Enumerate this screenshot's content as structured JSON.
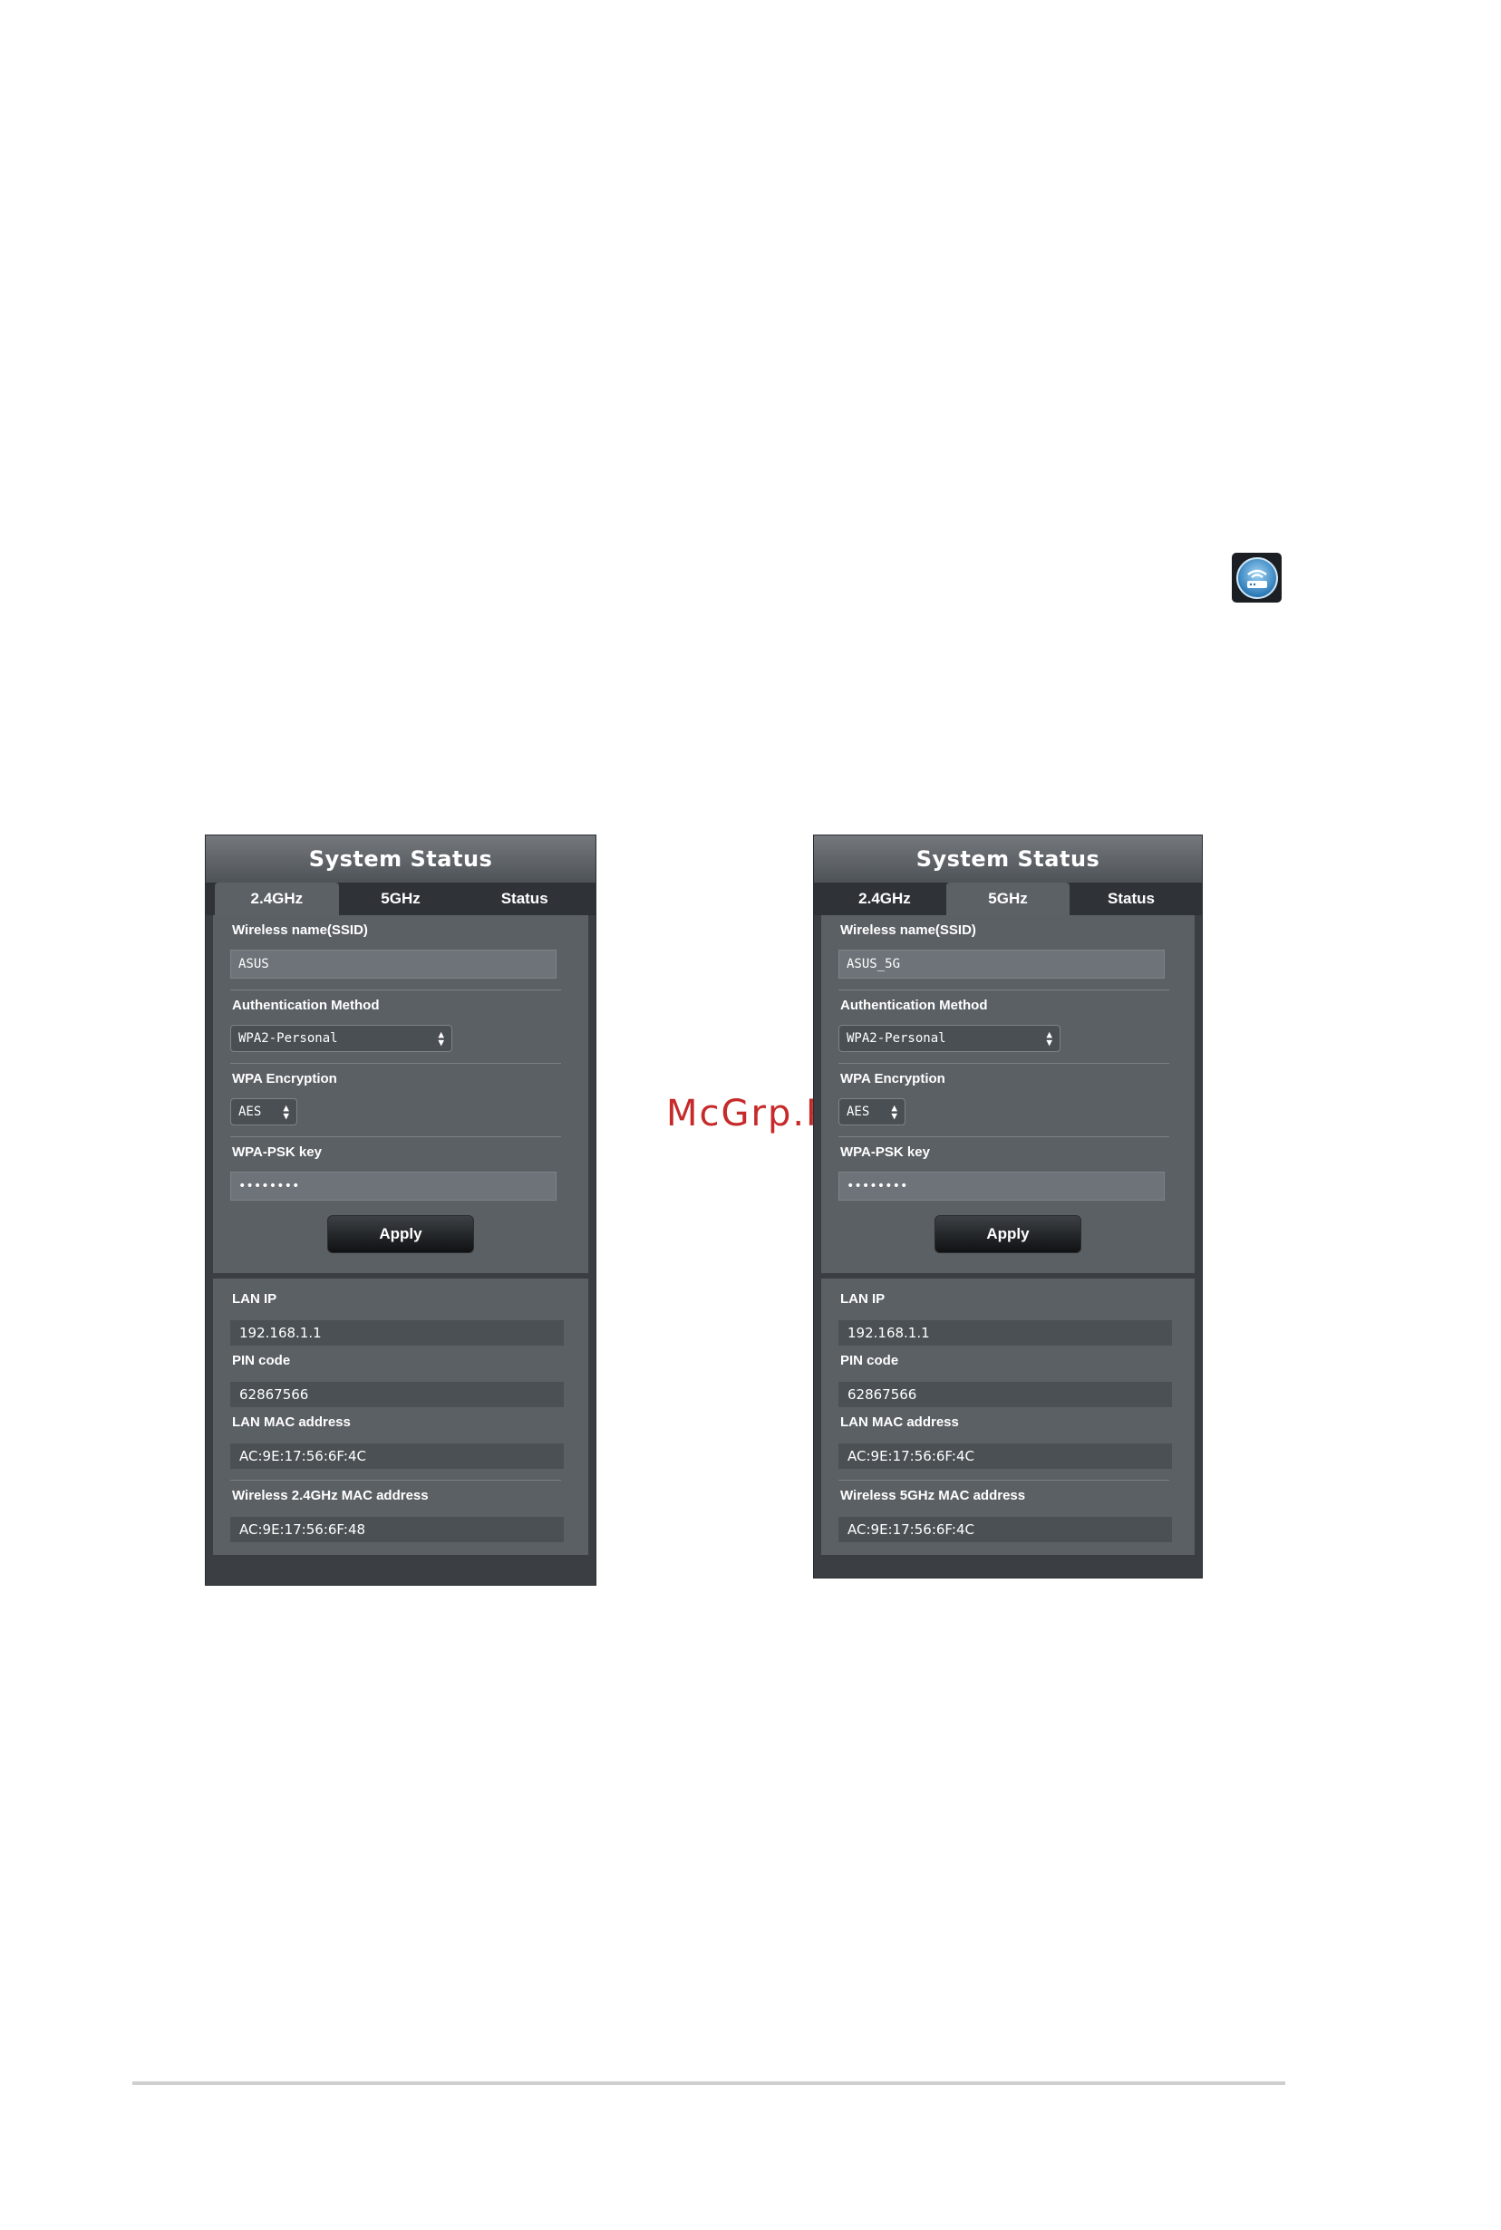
{
  "router_icon": "router-icon",
  "watermark": "McGrp.Ru",
  "panels": [
    {
      "title": "System Status",
      "tabs": [
        {
          "label": "2.4GHz",
          "active": true
        },
        {
          "label": "5GHz",
          "active": false
        },
        {
          "label": "Status",
          "active": false
        }
      ],
      "ssid_label": "Wireless name(SSID)",
      "ssid_value": "ASUS",
      "auth_label": "Authentication Method",
      "auth_value": "WPA2-Personal",
      "enc_label": "WPA Encryption",
      "enc_value": "AES",
      "psk_label": "WPA-PSK key",
      "psk_value": "••••••••",
      "apply_label": "Apply",
      "lan_ip_label": "LAN IP",
      "lan_ip_value": "192.168.1.1",
      "pin_label": "PIN code",
      "pin_value": "62867566",
      "lan_mac_label": "LAN MAC address",
      "lan_mac_value": "AC:9E:17:56:6F:4C",
      "wl_mac_label": "Wireless 2.4GHz MAC address",
      "wl_mac_value": "AC:9E:17:56:6F:48"
    },
    {
      "title": "System Status",
      "tabs": [
        {
          "label": "2.4GHz",
          "active": false
        },
        {
          "label": "5GHz",
          "active": true
        },
        {
          "label": "Status",
          "active": false
        }
      ],
      "ssid_label": "Wireless name(SSID)",
      "ssid_value": "ASUS_5G",
      "auth_label": "Authentication Method",
      "auth_value": "WPA2-Personal",
      "enc_label": "WPA Encryption",
      "enc_value": "AES",
      "psk_label": "WPA-PSK key",
      "psk_value": "••••••••",
      "apply_label": "Apply",
      "lan_ip_label": "LAN IP",
      "lan_ip_value": "192.168.1.1",
      "pin_label": "PIN code",
      "pin_value": "62867566",
      "lan_mac_label": "LAN MAC address",
      "lan_mac_value": "AC:9E:17:56:6F:4C",
      "wl_mac_label": "Wireless 5GHz MAC address",
      "wl_mac_value": "AC:9E:17:56:6F:4C"
    }
  ],
  "colors": {
    "panel_bg": "#3b3f43",
    "section_bg": "#5b6065",
    "watermark": "#c62a2a"
  }
}
